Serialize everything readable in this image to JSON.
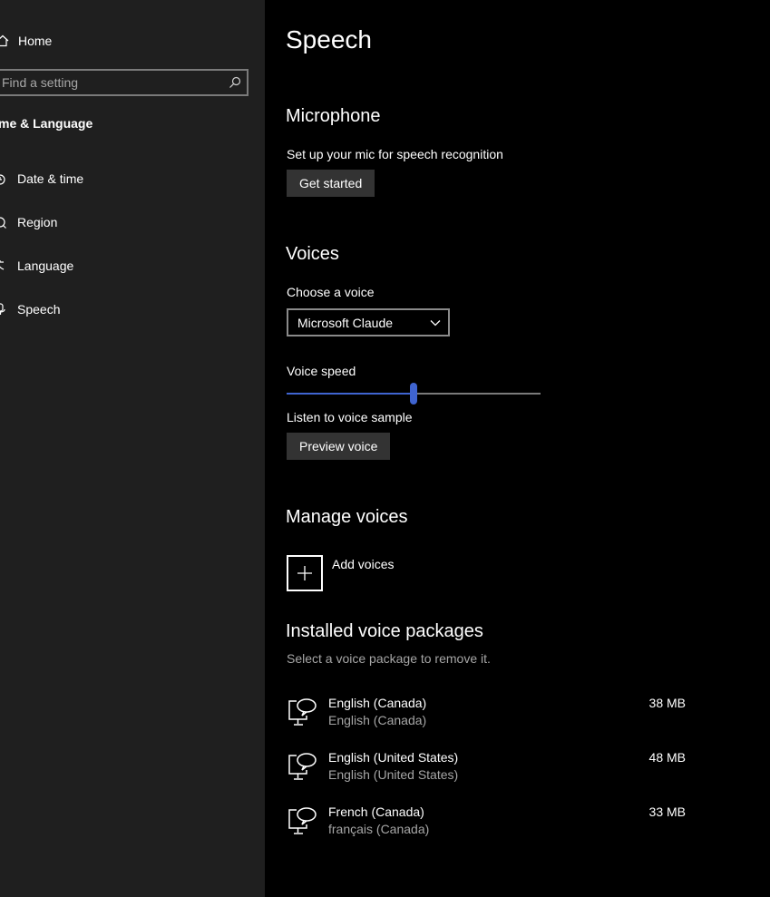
{
  "sidebar": {
    "home_label": "Home",
    "search_placeholder": "Find a setting",
    "section_title": "me & Language",
    "items": [
      {
        "label": "Date & time",
        "icon": "date-time-icon"
      },
      {
        "label": "Region",
        "icon": "region-icon"
      },
      {
        "label": "Language",
        "icon": "language-icon"
      },
      {
        "label": "Speech",
        "icon": "speech-icon"
      }
    ]
  },
  "main": {
    "title": "Speech",
    "microphone": {
      "heading": "Microphone",
      "description": "Set up your mic for speech recognition",
      "button_label": "Get started"
    },
    "voices": {
      "heading": "Voices",
      "choose_label": "Choose a voice",
      "selected_voice": "Microsoft Claude",
      "speed_label": "Voice speed",
      "speed_value": 0.5,
      "sample_label": "Listen to voice sample",
      "preview_button_label": "Preview voice"
    },
    "manage": {
      "heading": "Manage voices",
      "add_label": "Add voices"
    },
    "installed": {
      "heading": "Installed voice packages",
      "hint": "Select a voice package to remove it.",
      "packages": [
        {
          "name": "English (Canada)",
          "sub": "English (Canada)",
          "size": "38 MB"
        },
        {
          "name": "English (United States)",
          "sub": "English (United States)",
          "size": "48 MB"
        },
        {
          "name": "French (Canada)",
          "sub": "français (Canada)",
          "size": "33 MB"
        }
      ]
    }
  },
  "colors": {
    "sidebar_bg": "#1f1f1f",
    "main_bg": "#000000",
    "accent": "#3f64d0",
    "button_bg": "#333333",
    "secondary_text": "#a6a6a6"
  }
}
